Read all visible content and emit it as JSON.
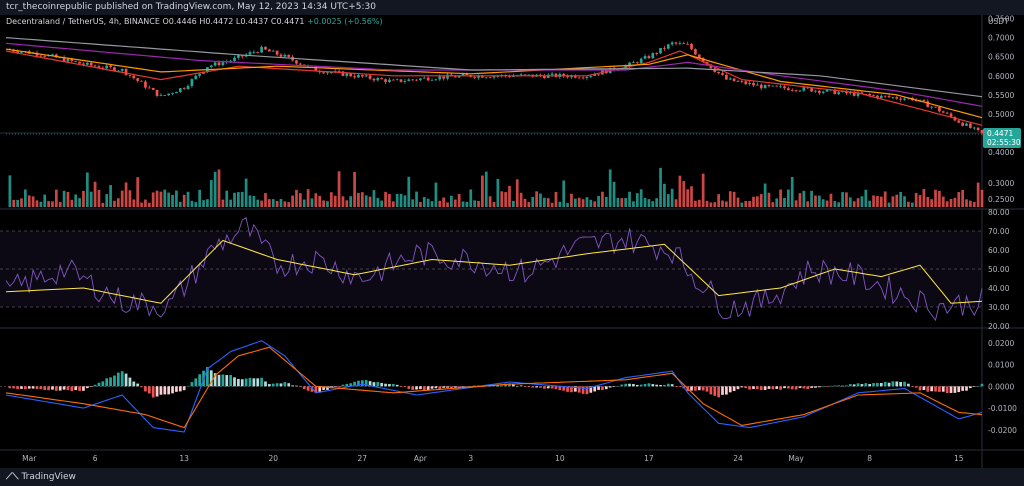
{
  "header": {
    "published": "tcr_thecoinrepublic published on TradingView.com, May 12, 2023 14:34 UTC+5:30"
  },
  "symbol": {
    "name": "Decentraland / TetherUS, 4h, BINANCE",
    "open": "O0.4446",
    "high": "H0.4472",
    "low": "L0.4437",
    "close": "C0.4471",
    "change": "+0.0025 (+0.56%)"
  },
  "currency": "USDT",
  "price_tag": {
    "value": "0.4471",
    "countdown": "02:55:30"
  },
  "footer": {
    "brand": "TradingView"
  },
  "colors": {
    "up": "#26a69a",
    "down": "#ef5350",
    "ema_red": "#e53935",
    "ema_orange": "#ff9800",
    "ema_purple": "#9c27b0",
    "ema_gray": "#9598a1",
    "rsi": "#7e57c2",
    "rsi_ma": "#ffeb3b",
    "macd": "#2962ff",
    "signal": "#ff6d00"
  },
  "chart_data": [
    {
      "type": "candlestick",
      "pane": "price",
      "ylim": [
        0.4,
        0.75
      ],
      "y_ticks": [
        "0.7500",
        "0.7000",
        "0.6500",
        "0.6000",
        "0.5500",
        "0.5000",
        "0.4500",
        "0.4000"
      ],
      "x_tick_labels": [
        "Mar",
        "6",
        "13",
        "20",
        "27",
        "Apr",
        "3",
        "10",
        "17",
        "24",
        "May",
        "8",
        "15"
      ],
      "close_path": [
        [
          0,
          0.67
        ],
        [
          10,
          0.655
        ],
        [
          20,
          0.63
        ],
        [
          30,
          0.615
        ],
        [
          40,
          0.545
        ],
        [
          46,
          0.57
        ],
        [
          52,
          0.625
        ],
        [
          58,
          0.64
        ],
        [
          66,
          0.67
        ],
        [
          72,
          0.65
        ],
        [
          80,
          0.615
        ],
        [
          90,
          0.6
        ],
        [
          100,
          0.585
        ],
        [
          110,
          0.595
        ],
        [
          120,
          0.6
        ],
        [
          130,
          0.6
        ],
        [
          140,
          0.6
        ],
        [
          150,
          0.6
        ],
        [
          160,
          0.625
        ],
        [
          166,
          0.65
        ],
        [
          172,
          0.685
        ],
        [
          176,
          0.68
        ],
        [
          180,
          0.64
        ],
        [
          186,
          0.59
        ],
        [
          196,
          0.57
        ],
        [
          206,
          0.565
        ],
        [
          216,
          0.555
        ],
        [
          226,
          0.545
        ],
        [
          234,
          0.54
        ],
        [
          240,
          0.515
        ],
        [
          246,
          0.48
        ],
        [
          252,
          0.4471
        ]
      ],
      "ma": [
        {
          "color": "ema_red",
          "path": [
            [
              0,
              0.665
            ],
            [
              40,
              0.59
            ],
            [
              60,
              0.625
            ],
            [
              100,
              0.6
            ],
            [
              150,
              0.6
            ],
            [
              166,
              0.635
            ],
            [
              174,
              0.665
            ],
            [
              190,
              0.59
            ],
            [
              220,
              0.555
            ],
            [
              252,
              0.47
            ]
          ]
        },
        {
          "color": "ema_orange",
          "path": [
            [
              0,
              0.67
            ],
            [
              40,
              0.61
            ],
            [
              70,
              0.625
            ],
            [
              120,
              0.605
            ],
            [
              166,
              0.63
            ],
            [
              176,
              0.655
            ],
            [
              200,
              0.585
            ],
            [
              230,
              0.55
            ],
            [
              252,
              0.49
            ]
          ]
        },
        {
          "color": "ema_purple",
          "path": [
            [
              0,
              0.685
            ],
            [
              50,
              0.64
            ],
            [
              100,
              0.615
            ],
            [
              160,
              0.615
            ],
            [
              176,
              0.635
            ],
            [
              200,
              0.6
            ],
            [
              230,
              0.56
            ],
            [
              252,
              0.52
            ]
          ]
        },
        {
          "color": "ema_gray",
          "path": [
            [
              0,
              0.7
            ],
            [
              60,
              0.655
            ],
            [
              120,
              0.615
            ],
            [
              176,
              0.62
            ],
            [
              210,
              0.6
            ],
            [
              252,
              0.545
            ]
          ]
        }
      ]
    },
    {
      "type": "bar",
      "pane": "volume",
      "y_ticks": [
        "0.3000",
        "0.2500"
      ]
    },
    {
      "type": "line",
      "pane": "rsi",
      "ylim": [
        20,
        80
      ],
      "y_ticks": [
        "80.00",
        "70.00",
        "60.00",
        "50.00",
        "40.00",
        "30.00",
        "20.00"
      ],
      "bands": [
        30,
        50,
        70
      ],
      "rsi_path": [
        [
          0,
          38
        ],
        [
          15,
          50
        ],
        [
          30,
          33
        ],
        [
          42,
          30
        ],
        [
          54,
          62
        ],
        [
          62,
          72
        ],
        [
          70,
          52
        ],
        [
          80,
          55
        ],
        [
          92,
          45
        ],
        [
          106,
          58
        ],
        [
          120,
          55
        ],
        [
          134,
          48
        ],
        [
          148,
          62
        ],
        [
          160,
          66
        ],
        [
          172,
          60
        ],
        [
          176,
          50
        ],
        [
          186,
          29
        ],
        [
          196,
          33
        ],
        [
          208,
          50
        ],
        [
          220,
          46
        ],
        [
          230,
          38
        ],
        [
          240,
          30
        ],
        [
          252,
          33
        ]
      ],
      "ma_path": [
        [
          0,
          38
        ],
        [
          20,
          40
        ],
        [
          40,
          32
        ],
        [
          56,
          65
        ],
        [
          70,
          55
        ],
        [
          90,
          47
        ],
        [
          110,
          55
        ],
        [
          130,
          52
        ],
        [
          150,
          58
        ],
        [
          170,
          63
        ],
        [
          184,
          36
        ],
        [
          200,
          40
        ],
        [
          214,
          50
        ],
        [
          226,
          46
        ],
        [
          236,
          52
        ],
        [
          244,
          32
        ],
        [
          252,
          33
        ]
      ]
    },
    {
      "type": "bar",
      "pane": "macd",
      "ylim": [
        -0.027,
        0.025
      ],
      "y_ticks": [
        "0.0200",
        "0.0100",
        "0.0000",
        "-0.0100",
        "-0.0200"
      ],
      "macd_path": [
        [
          0,
          -0.004
        ],
        [
          10,
          -0.007
        ],
        [
          20,
          -0.01
        ],
        [
          30,
          -0.004
        ],
        [
          38,
          -0.019
        ],
        [
          46,
          -0.021
        ],
        [
          52,
          0.008
        ],
        [
          58,
          0.016
        ],
        [
          66,
          0.021
        ],
        [
          72,
          0.014
        ],
        [
          80,
          -0.003
        ],
        [
          92,
          0.001
        ],
        [
          106,
          -0.004
        ],
        [
          130,
          0.002
        ],
        [
          150,
          -0.001
        ],
        [
          160,
          0.004
        ],
        [
          172,
          0.007
        ],
        [
          176,
          -0.003
        ],
        [
          184,
          -0.017
        ],
        [
          192,
          -0.019
        ],
        [
          206,
          -0.014
        ],
        [
          220,
          -0.003
        ],
        [
          232,
          -0.001
        ],
        [
          240,
          -0.009
        ],
        [
          246,
          -0.015
        ],
        [
          252,
          -0.012
        ]
      ],
      "signal_path": [
        [
          0,
          -0.003
        ],
        [
          20,
          -0.008
        ],
        [
          36,
          -0.013
        ],
        [
          46,
          -0.019
        ],
        [
          54,
          0.005
        ],
        [
          60,
          0.014
        ],
        [
          68,
          0.018
        ],
        [
          80,
          0.0
        ],
        [
          100,
          -0.003
        ],
        [
          130,
          0.001
        ],
        [
          160,
          0.003
        ],
        [
          172,
          0.006
        ],
        [
          180,
          -0.008
        ],
        [
          190,
          -0.018
        ],
        [
          206,
          -0.013
        ],
        [
          220,
          -0.004
        ],
        [
          236,
          -0.003
        ],
        [
          246,
          -0.012
        ],
        [
          252,
          -0.013
        ]
      ]
    }
  ]
}
